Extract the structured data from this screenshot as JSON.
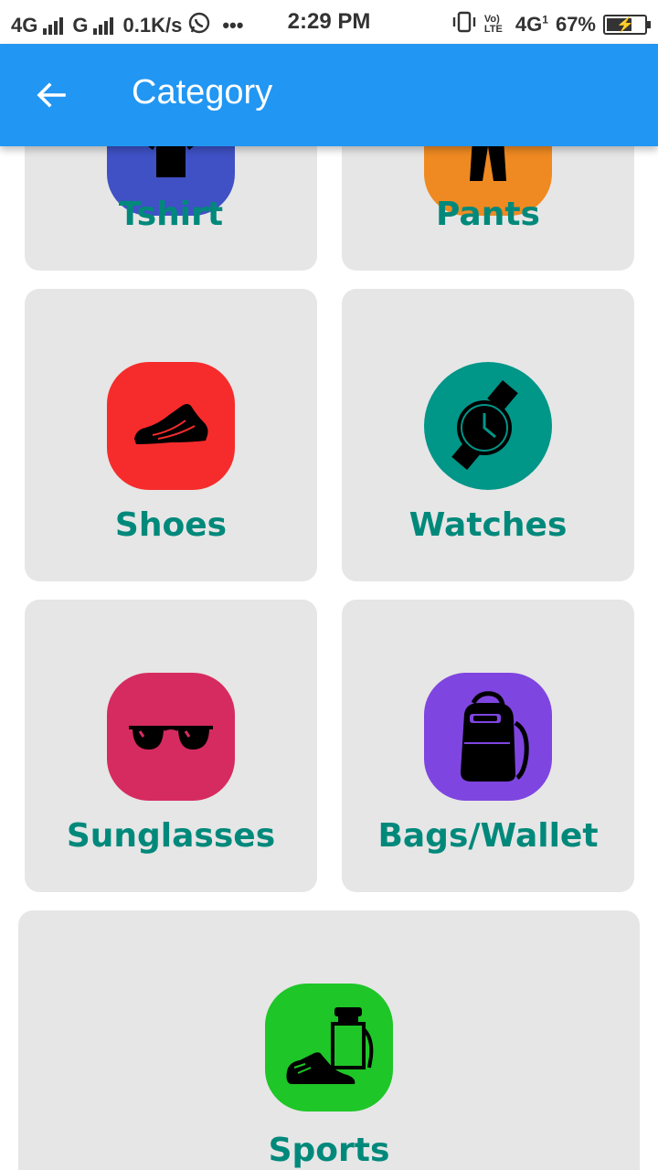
{
  "status_bar": {
    "network_1": "4G",
    "network_2": "G",
    "speed": "0.1K/s",
    "more": "•••",
    "time": "2:29 PM",
    "volte": "Vo) LTE",
    "network_3": "4G",
    "sim": "1",
    "battery_percent": "67%",
    "battery_level": 0.67
  },
  "app_bar": {
    "title": "Category",
    "back_icon": "arrow-back-icon",
    "background": "#2196f3"
  },
  "categories": [
    {
      "label": "Tshirt",
      "icon": "tshirt-icon",
      "color": "#3f51c5"
    },
    {
      "label": "Pants",
      "icon": "pants-icon",
      "color": "#ef8a22"
    },
    {
      "label": "Shoes",
      "icon": "shoe-icon",
      "color": "#f62c2c"
    },
    {
      "label": "Watches",
      "icon": "watch-icon",
      "color": "#009688"
    },
    {
      "label": "Sunglasses",
      "icon": "sunglasses-icon",
      "color": "#d62b60"
    },
    {
      "label": "Bags/Wallet",
      "icon": "backpack-icon",
      "color": "#7f45e0"
    },
    {
      "label": "Sports",
      "icon": "sports-icon",
      "color": "#1ec628"
    }
  ],
  "label_color": "#00897b",
  "card_color": "#e6e6e6"
}
